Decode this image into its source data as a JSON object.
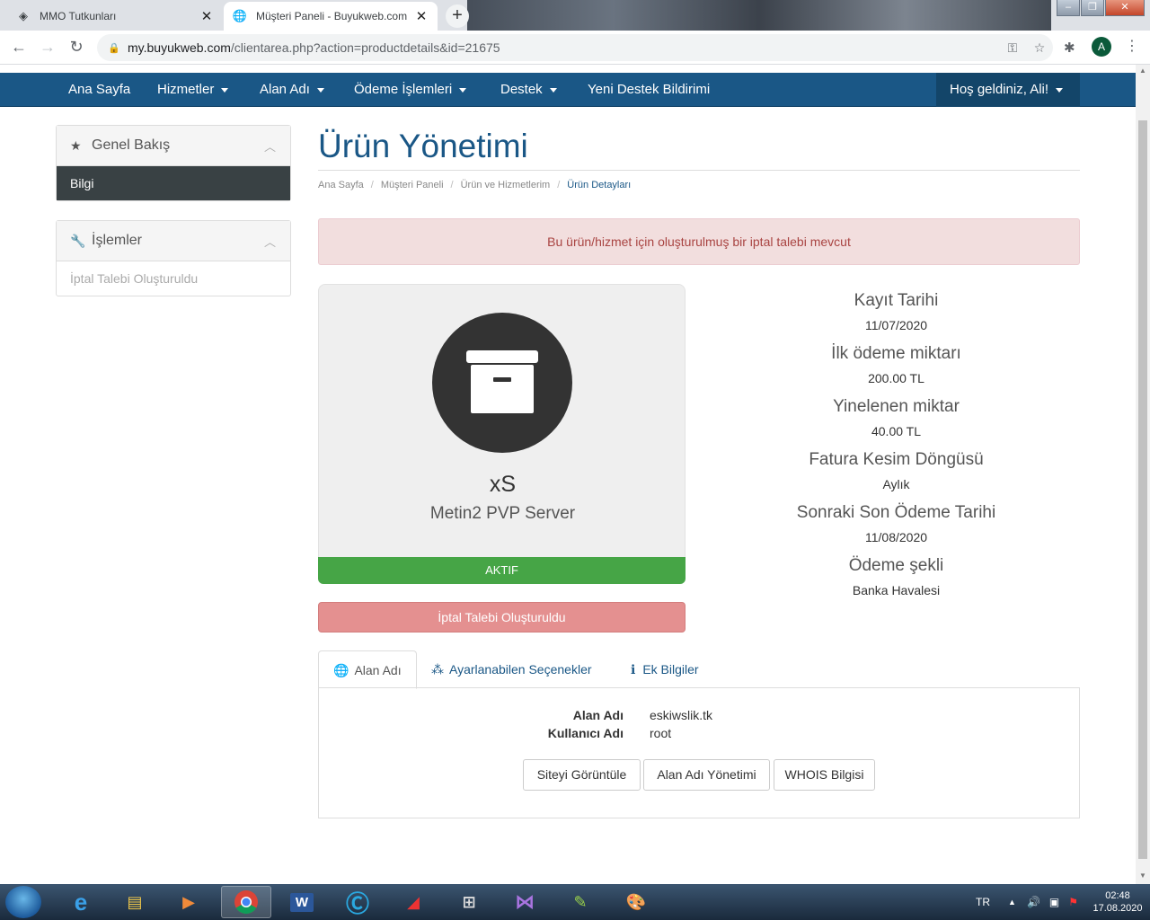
{
  "browser": {
    "tabs": [
      {
        "title": "MMO Tutkunları",
        "icon": "diamond-icon"
      },
      {
        "title": "Müşteri Paneli - Buyukweb.com",
        "icon": "globe-icon"
      }
    ],
    "new_tab": "+",
    "url_host": "my.buyukweb.com",
    "url_path": "/clientarea.php?action=productdetails&id=21675",
    "profile_initial": "A"
  },
  "site_nav": {
    "items": [
      "Ana Sayfa",
      "Hizmetler",
      "Alan Adı",
      "Ödeme İşlemleri",
      "Destek",
      "Yeni Destek Bildirimi"
    ],
    "welcome": "Hoş geldiniz, Ali!"
  },
  "sidebar": {
    "overview": {
      "title": "Genel Bakış",
      "active_item": "Bilgi"
    },
    "actions": {
      "title": "İşlemler",
      "item": "İptal Talebi Oluşturuldu"
    }
  },
  "page": {
    "title": "Ürün Yönetimi",
    "breadcrumb": [
      "Ana Sayfa",
      "Müşteri Paneli",
      "Ürün ve Hizmetlerim",
      "Ürün Detayları"
    ],
    "alert": "Bu ürün/hizmet için oluşturulmuş bir iptal talebi mevcut"
  },
  "product": {
    "name": "xS",
    "group": "Metin2 PVP Server",
    "status": "AKTIF",
    "cancel_label": "İptal Talebi Oluşturuldu"
  },
  "details": [
    {
      "label": "Kayıt Tarihi",
      "value": "11/07/2020"
    },
    {
      "label": "İlk ödeme miktarı",
      "value": "200.00 TL"
    },
    {
      "label": "Yinelenen miktar",
      "value": "40.00 TL"
    },
    {
      "label": "Fatura Kesim Döngüsü",
      "value": "Aylık"
    },
    {
      "label": "Sonraki Son Ödeme Tarihi",
      "value": "11/08/2020"
    },
    {
      "label": "Ödeme şekli",
      "value": "Banka Havalesi"
    }
  ],
  "tabs": [
    "Alan Adı",
    "Ayarlanabilen Seçenekler",
    "Ek Bilgiler"
  ],
  "domain_pane": {
    "rows": [
      {
        "key": "Alan Adı",
        "value": "eskiwslik.tk"
      },
      {
        "key": "Kullanıcı Adı",
        "value": "root"
      }
    ],
    "buttons": [
      "Siteyi Görüntüle",
      "Alan Adı Yönetimi",
      "WHOIS Bilgisi"
    ]
  },
  "taskbar": {
    "language": "TR",
    "time": "02:48",
    "date": "17.08.2020"
  },
  "colors": {
    "brand": "#1a5786",
    "success": "#46a546",
    "danger_soft": "#e49090",
    "alert_bg": "#f2dede"
  }
}
